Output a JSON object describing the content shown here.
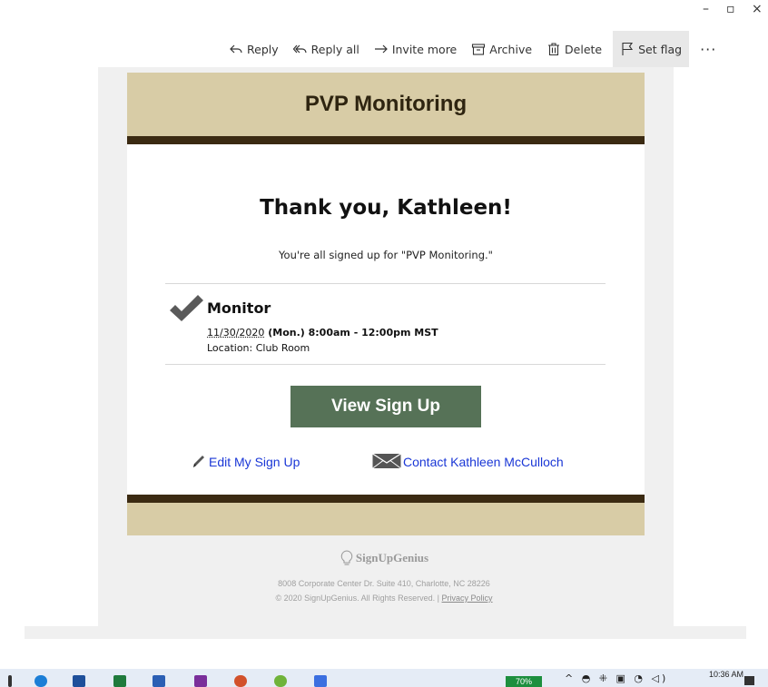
{
  "window": {
    "minimize_label": "–",
    "restore_label": "▫",
    "close_label": "×"
  },
  "toolbar": {
    "reply": "Reply",
    "reply_all": "Reply all",
    "invite_more": "Invite more",
    "archive": "Archive",
    "delete": "Delete",
    "set_flag": "Set flag",
    "more": "···"
  },
  "email": {
    "banner_title": "PVP Monitoring",
    "thanks": "Thank you, Kathleen!",
    "subtext": "You're all signed up for \"PVP Monitoring.\"",
    "slot": {
      "title": "Monitor",
      "date": "11/30/2020",
      "time": " (Mon.) 8:00am - 12:00pm MST",
      "location": "Location: Club Room"
    },
    "view_button": "View Sign Up",
    "edit_link": "Edit My Sign Up",
    "contact_link": "Contact Kathleen McCulloch",
    "colors": {
      "banner": "#d8cca6",
      "dark_bar": "#3b2a12",
      "button": "#567257",
      "link": "#1a37d6"
    }
  },
  "footer": {
    "logo_text": "SignUpGenius",
    "address": "8008 Corporate Center Dr. Suite 410, Charlotte, NC 28226",
    "copyright": "© 2020 SignUpGenius. All Rights Reserved. | ",
    "privacy": "Privacy Policy"
  },
  "taskbar": {
    "battery": "70%",
    "clock": "10:36 AM"
  }
}
